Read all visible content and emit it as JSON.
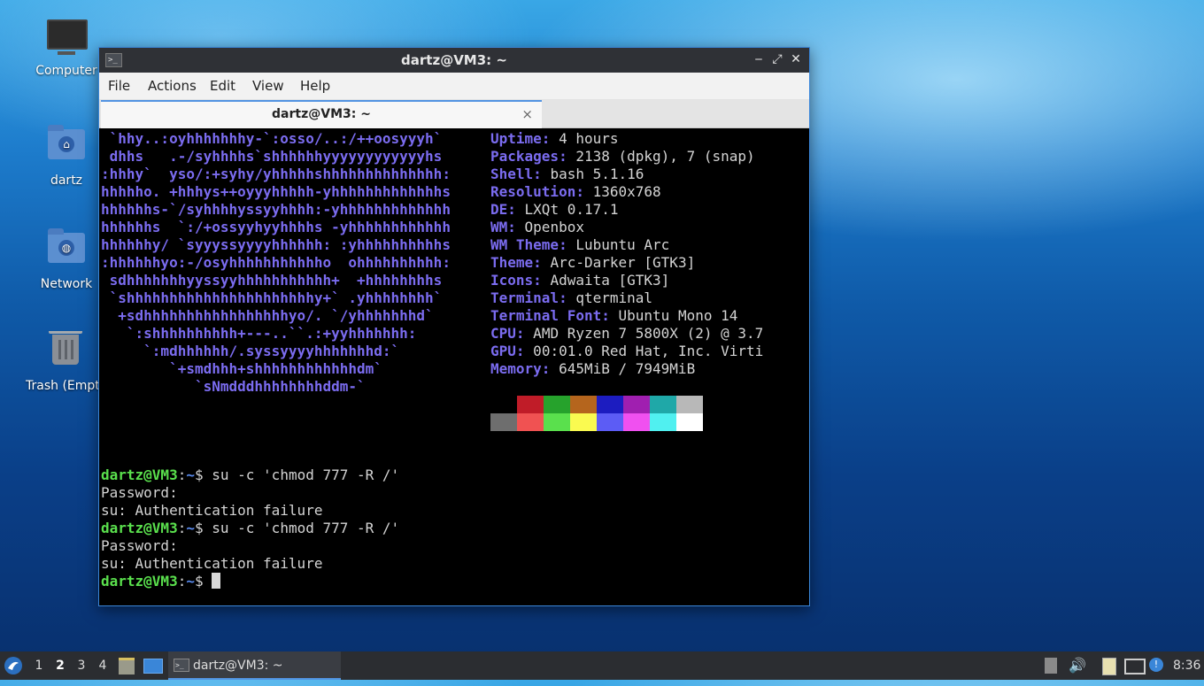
{
  "desktop": {
    "icons": [
      {
        "label": "Computer",
        "icon": "computer-icon"
      },
      {
        "label": "dartz",
        "icon": "home-folder-icon"
      },
      {
        "label": "Network",
        "icon": "network-folder-icon"
      },
      {
        "label": "Trash (Empty)",
        "icon": "trash-icon"
      }
    ]
  },
  "window": {
    "title": "dartz@VM3: ~",
    "menu": [
      "File",
      "Actions",
      "Edit",
      "View",
      "Help"
    ],
    "tab_label": "dartz@VM3: ~",
    "tab_close": "×",
    "controls": {
      "minimize": "‒",
      "maximize": "⤢",
      "close": "✕"
    }
  },
  "terminal": {
    "logo_lines": [
      " `hhy..:oyhhhhhhhy-`:osso/..:/++oosyyyh`",
      " dhhs   .-/syhhhhs`shhhhhhyyyyyyyyyyyyhs",
      ":hhhy`  yso/:+syhy/yhhhhhshhhhhhhhhhhhhh:",
      "hhhhho. +hhhys++oyyyhhhhh-yhhhhhhhhhhhhhs",
      "hhhhhhs-`/syhhhhyssyyhhhh:-yhhhhhhhhhhhhh",
      "hhhhhhs  `:/+ossyyhyyhhhhs -yhhhhhhhhhhhh",
      "hhhhhhy/ `syyyssyyyyhhhhhh: :yhhhhhhhhhhs",
      ":hhhhhhyo:-/osyhhhhhhhhhhho  ohhhhhhhhhh:",
      " sdhhhhhhhyyssyyhhhhhhhhhhh+  +hhhhhhhhs",
      " `shhhhhhhhhhhhhhhhhhhhhhy+` .yhhhhhhhh`",
      "  +sdhhhhhhhhhhhhhhhhhyo/. `/yhhhhhhhd`",
      "   `:shhhhhhhhhh+---..``.:+yyhhhhhhh:",
      "     `:mdhhhhhh/.syssyyyyhhhhhhhd:`",
      "        `+smdhhh+shhhhhhhhhhhhdm`",
      "           `sNmdddhhhhhhhhddm-`"
    ],
    "info": [
      {
        "key": "Uptime",
        "value": " 4 hours"
      },
      {
        "key": "Packages",
        "value": " 2138 (dpkg), 7 (snap)"
      },
      {
        "key": "Shell",
        "value": " bash 5.1.16"
      },
      {
        "key": "Resolution",
        "value": " 1360x768"
      },
      {
        "key": "DE",
        "value": " LXQt 0.17.1"
      },
      {
        "key": "WM",
        "value": " Openbox"
      },
      {
        "key": "WM Theme",
        "value": " Lubuntu Arc"
      },
      {
        "key": "Theme",
        "value": " Arc-Darker [GTK3]"
      },
      {
        "key": "Icons",
        "value": " Adwaita [GTK3]"
      },
      {
        "key": "Terminal",
        "value": " qterminal"
      },
      {
        "key": "Terminal Font",
        "value": " Ubuntu Mono 14"
      },
      {
        "key": "CPU",
        "value": " AMD Ryzen 7 5800X (2) @ 3.7"
      },
      {
        "key": "GPU",
        "value": " 00:01.0 Red Hat, Inc. Virti"
      },
      {
        "key": "Memory",
        "value": " 645MiB / 7949MiB"
      }
    ],
    "palette_top": [
      "#000000",
      "#c01c28",
      "#26a22c",
      "#b5651d",
      "#1c1cc0",
      "#a01fb0",
      "#1fa8a8",
      "#b8b8b8"
    ],
    "palette_bottom": [
      "#6e6e6e",
      "#f05252",
      "#5ae04d",
      "#fafa50",
      "#5c5cf5",
      "#f050f0",
      "#50f0f0",
      "#ffffff"
    ],
    "session": [
      {
        "type": "prompt",
        "user": "dartz@VM3",
        "path": "~",
        "cmd": "$ su -c 'chmod 777 -R /'"
      },
      {
        "type": "out",
        "text": "Password:"
      },
      {
        "type": "out",
        "text": "su: Authentication failure"
      },
      {
        "type": "prompt",
        "user": "dartz@VM3",
        "path": "~",
        "cmd": "$ su -c 'chmod 777 -R /'"
      },
      {
        "type": "out",
        "text": "Password:"
      },
      {
        "type": "out",
        "text": "su: Authentication failure"
      },
      {
        "type": "prompt",
        "user": "dartz@VM3",
        "path": "~",
        "cmd": "$ "
      }
    ]
  },
  "taskbar": {
    "workspaces": [
      "1",
      "2",
      "3",
      "4"
    ],
    "active_workspace": "2",
    "task_label": "dartz@VM3: ~",
    "clock": "8:36",
    "tray_icons": [
      "update-notifier-icon",
      "volume-icon",
      "clipboard-icon",
      "network-icon",
      "notification-icon"
    ]
  }
}
